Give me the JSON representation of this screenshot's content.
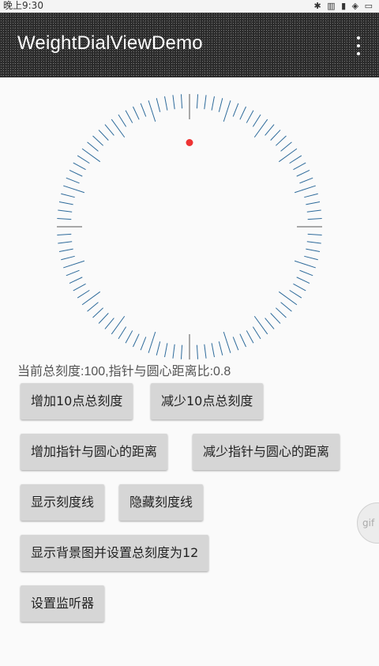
{
  "status": {
    "time": "晚上9:30",
    "icons": "✱ ▥ ▮ ◈ ▭"
  },
  "appbar": {
    "title": "WeightDialViewDemo"
  },
  "dial": {
    "total_ticks": 100,
    "pointer_ratio": 0.8,
    "tick_color": "#2d6a9a",
    "pointer_color": "#ee3333"
  },
  "info": {
    "text": "当前总刻度:100,指针与圆心距离比:0.8"
  },
  "buttons": {
    "add10": "增加10点总刻度",
    "sub10": "减少10点总刻度",
    "inc_dist": "增加指针与圆心的距离",
    "dec_dist": "减少指针与圆心的距离",
    "show_ticks": "显示刻度线",
    "hide_ticks": "隐藏刻度线",
    "bg12": "显示背景图并设置总刻度为12",
    "listener": "设置监听器"
  },
  "fab": {
    "label": "gif"
  }
}
